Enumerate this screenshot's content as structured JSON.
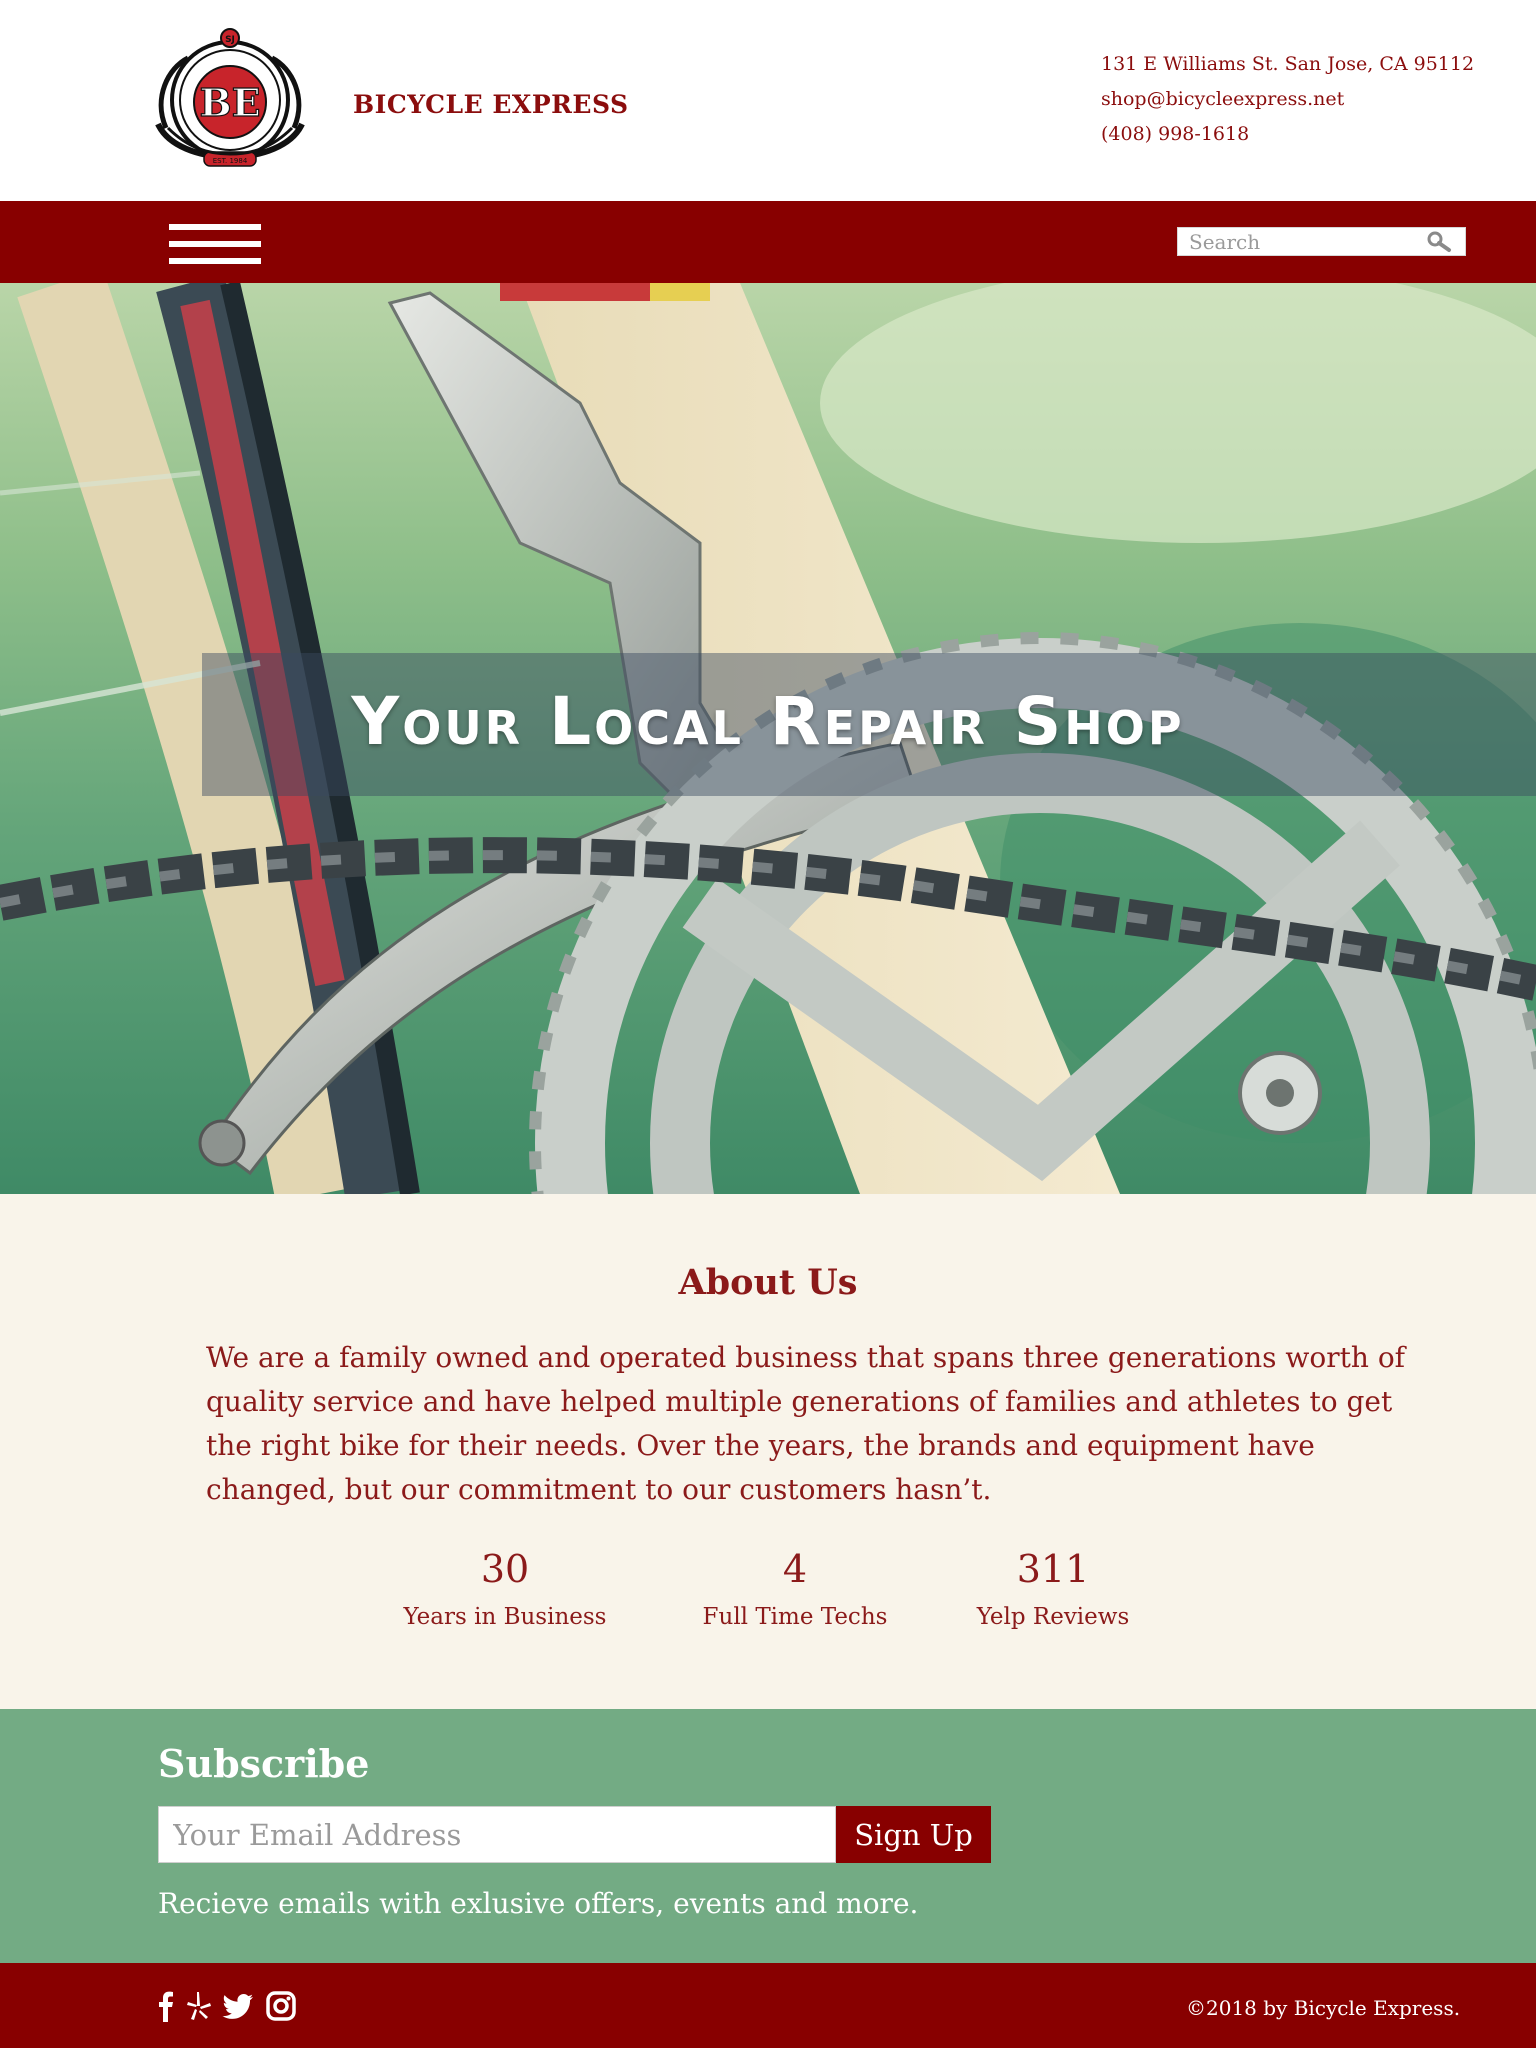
{
  "header": {
    "brand_name": "BICYCLE EXPRESS",
    "logo_text": {
      "top": "SJ",
      "ring": "BICYCLE EXPRESS",
      "initials": "BE",
      "est": "EST. 1984"
    },
    "address": "131 E Williams St. San Jose, CA 95112",
    "email": "shop@bicycleexpress.net",
    "phone": "(408) 998-1618"
  },
  "nav": {
    "menu_icon": "hamburger-menu-icon",
    "search": {
      "placeholder": "Search",
      "value": "",
      "icon": "search-icon"
    }
  },
  "hero": {
    "title": "Your Local Repair Shop",
    "image": "bicycle-crankset-photo"
  },
  "about": {
    "title": "About Us",
    "text": "We are a family owned and operated business that spans three generations worth of quality service and have helped multiple generations of families and athletes to get the right bike for their needs. Over the years, the brands and equipment have changed, but our commitment to our customers hasn’t.",
    "stats": [
      {
        "value": "30",
        "label": "Years in Business"
      },
      {
        "value": "4",
        "label": "Full Time Techs"
      },
      {
        "value": "311",
        "label": "Yelp Reviews"
      }
    ]
  },
  "subscribe": {
    "title": "Subscribe",
    "email_placeholder": "Your Email Address",
    "email_value": "",
    "button_label": "Sign Up",
    "description": "Recieve emails with exlusive offers, events and more."
  },
  "footer": {
    "social_icons": [
      "facebook-icon",
      "yelp-icon",
      "twitter-icon",
      "instagram-icon"
    ],
    "copyright": "©2018 by Bicycle Express."
  },
  "colors": {
    "brand_red": "#880000",
    "text_red": "#8b1a1a",
    "about_bg": "#f9f4ea",
    "subscribe_green": "#73ab84",
    "white": "#ffffff"
  }
}
